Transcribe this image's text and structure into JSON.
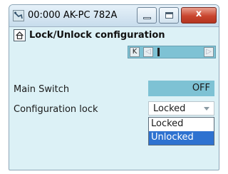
{
  "window": {
    "title": "00:000 AK-PC 782A",
    "close_symbol": "x"
  },
  "header": {
    "title": "Lock/Unlock configuration",
    "icon": "home-icon"
  },
  "nav": {
    "first": "K",
    "prev": "◁",
    "next": "▷"
  },
  "fields": {
    "main_switch": {
      "label": "Main Switch",
      "value": "OFF"
    },
    "configuration_lock": {
      "label": "Configuration lock",
      "value": "Locked",
      "options": [
        "Locked",
        "Unlocked"
      ],
      "highlighted_option": "Unlocked"
    }
  },
  "colors": {
    "accent": "#7ec2d4",
    "background": "#dcf1f6",
    "selection": "#2e72d0",
    "close": "#c9452e"
  }
}
